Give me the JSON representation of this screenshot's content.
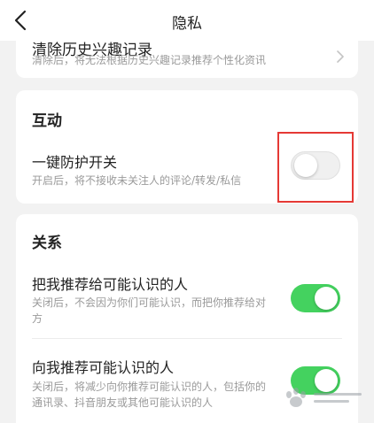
{
  "header": {
    "title": "隐私",
    "back_icon": "chevron-left-icon"
  },
  "history_row": {
    "title": "清除历史兴趣记录",
    "subtitle": "清除后，将无法根据历史兴趣记录推荐个性化资讯"
  },
  "interaction": {
    "section_title": "互动",
    "protect": {
      "title": "一键防护开关",
      "subtitle": "开启后，将不接收未关注人的评论/转发/私信",
      "enabled": false
    }
  },
  "relations": {
    "section_title": "关系",
    "recommend_me": {
      "title": "把我推荐给可能认识的人",
      "subtitle_line1": "关闭后，不会因为你们可能认识，而把你推荐给对",
      "subtitle_line2": "方",
      "enabled": true
    },
    "recommend_to_me": {
      "title": "向我推荐可能认识的人",
      "subtitle_line1": "关闭后，将减少向你推荐可能认识的人，包括你的",
      "subtitle_line2": "通讯录、抖音朋友或其他可能认识的人",
      "enabled": true
    }
  },
  "colors": {
    "toggle_on": "#44d25f",
    "toggle_off": "#f0f0f0",
    "highlight": "#e53935"
  },
  "watermark": {
    "icon": "baidu-paw-logo-icon"
  }
}
